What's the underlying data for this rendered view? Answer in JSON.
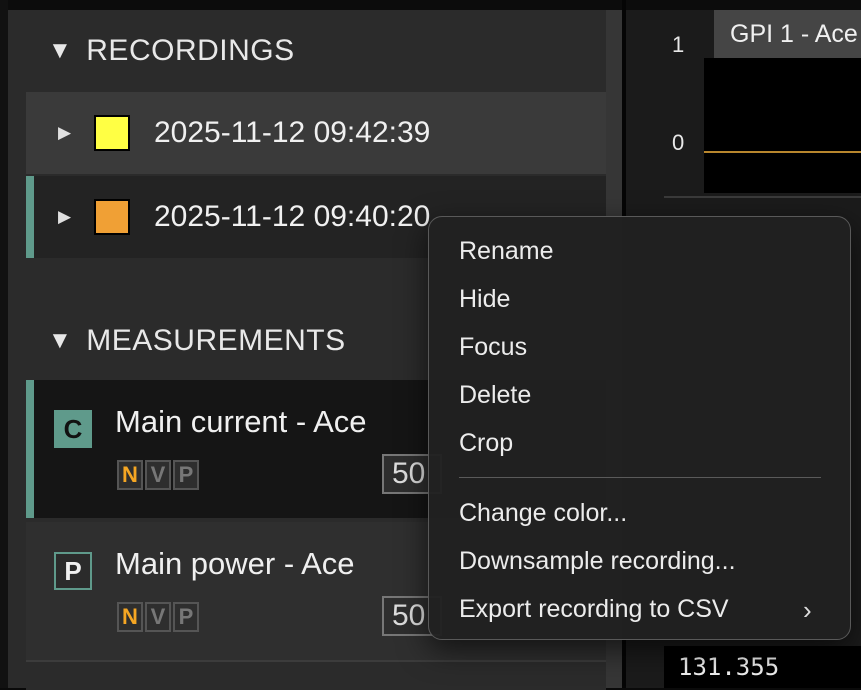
{
  "sections": {
    "recordings": "RECORDINGS",
    "measurements": "MEASUREMENTS"
  },
  "recordings": [
    {
      "label": "2025-11-12 09:42:39",
      "color": "#ffff44"
    },
    {
      "label": "2025-11-12 09:40:20",
      "color": "#f0a035"
    }
  ],
  "measurements": [
    {
      "icon": "C",
      "title": "Main current - Ace",
      "flags": [
        "N",
        "V",
        "P"
      ],
      "value": "50"
    },
    {
      "icon": "P",
      "title": "Main power - Ace",
      "flags": [
        "N",
        "V",
        "P"
      ],
      "value": "50"
    }
  ],
  "graph": {
    "tab_title": "GPI 1 - Ace",
    "axis_top": "1",
    "axis_zero": "0",
    "readout": "131.355"
  },
  "context_menu": {
    "rename": "Rename",
    "hide": "Hide",
    "focus": "Focus",
    "delete": "Delete",
    "crop": "Crop",
    "change_color": "Change color...",
    "downsample": "Downsample recording...",
    "export_csv": "Export recording to CSV"
  },
  "colors": {
    "accent": "#5f9a8b",
    "active_flag": "#f5a623",
    "trace": "#b8862d"
  }
}
